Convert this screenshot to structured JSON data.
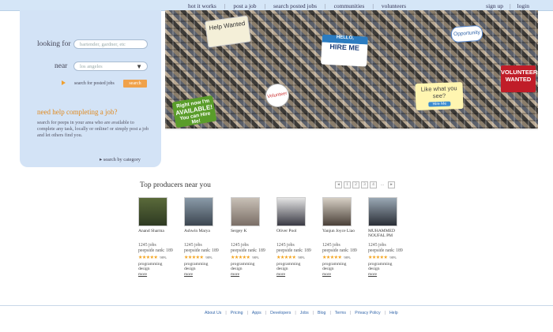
{
  "nav": {
    "items": [
      "hot it works",
      "post a job",
      "search posted jobs",
      "communities",
      "volunteers"
    ],
    "signup": "sign up",
    "login": "login"
  },
  "search": {
    "looking_for_label": "looking for",
    "looking_for_placeholder": "bartender, gardner, etc",
    "near_label": "near",
    "near_value": "los angeles",
    "posted_jobs_label": "search for posted jobs",
    "button": "search"
  },
  "help": {
    "title": "need help completing a job?",
    "text": "search for peeps in your area who are available to complete any task, locally or online! or simply post a job and let others find you.",
    "category_link": "search by category"
  },
  "collage": {
    "help_wanted": "Help Wanted",
    "hello": "HELLO,",
    "hire_me": "HIRE ME",
    "opportunity": "Opportunity",
    "volunteer": "Volunteer",
    "like_what": "Like what you see?",
    "hire_me_btn": "Hire Me",
    "volunteers_wanted": "VOLUNTEERS WANTED",
    "available_top": "Right now I'm",
    "available_mid": "AVAILABLE!",
    "available_bottom": "You can Hire Me!"
  },
  "producers": {
    "title": "Top producers near you",
    "pager": [
      "1",
      "2",
      "3",
      "4",
      "..."
    ],
    "people": [
      {
        "name": "Anand Sharma",
        "jobs": "1245 jobs",
        "rank": "peepside rank: 189",
        "pct": "98%",
        "skills": "programming design",
        "more": "more"
      },
      {
        "name": "Ashwin Marya",
        "jobs": "1245 jobs",
        "rank": "peepside rank: 189",
        "pct": "98%",
        "skills": "programming design",
        "more": "more"
      },
      {
        "name": "Sergey K",
        "jobs": "1245 jobs",
        "rank": "peepside rank: 189",
        "pct": "98%",
        "skills": "programming design",
        "more": "more"
      },
      {
        "name": "Oliver Pool",
        "jobs": "1245 jobs",
        "rank": "peepside rank: 189",
        "pct": "98%",
        "skills": "programming design",
        "more": "more"
      },
      {
        "name": "Yanjun Joyce Liao",
        "jobs": "1245 jobs",
        "rank": "peepside rank: 189",
        "pct": "98%",
        "skills": "programming design",
        "more": "more"
      },
      {
        "name": "MUHAMMED NOUFAL PM",
        "jobs": "1245 jobs",
        "rank": "peepside rank: 189",
        "pct": "98%",
        "skills": "programming design",
        "more": "more"
      }
    ]
  },
  "footer": [
    "About Us",
    "Pricing",
    "Apps",
    "Developers",
    "Jobs",
    "Blog",
    "Terms",
    "Privacy Policy",
    "Help"
  ]
}
